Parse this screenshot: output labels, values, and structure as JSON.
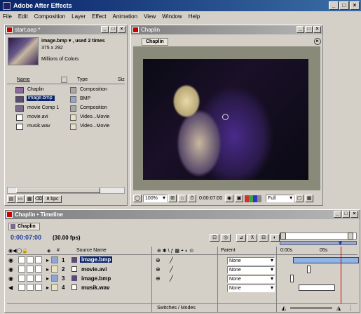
{
  "app": {
    "title": "Adobe After Effects"
  },
  "menu": [
    "File",
    "Edit",
    "Composition",
    "Layer",
    "Effect",
    "Animation",
    "View",
    "Window",
    "Help"
  ],
  "project": {
    "title": "start.aep *",
    "preview_name": "image.bmp ▾ , used 2 times",
    "preview_dims": "375 x 292",
    "preview_colors": "Millions of Colors",
    "col_name": "Name",
    "col_type": "Type",
    "col_extra": "Siz",
    "items": [
      {
        "name": "Chaplin",
        "type": "Composition",
        "swatch": "#a8a8a8"
      },
      {
        "name": "image.bmp",
        "type": "BMP",
        "swatch": "#8fa5d8"
      },
      {
        "name": "movie Comp 1",
        "type": "Composition",
        "swatch": "#a8a8a8"
      },
      {
        "name": "movie.avi",
        "type": "Video...Movie",
        "swatch": "#e8e0c0"
      },
      {
        "name": "musik.wav",
        "type": "Video...Movie",
        "swatch": "#e8e0c0"
      }
    ],
    "footer_bpc": "8 bpc"
  },
  "comp": {
    "title": "Chaplin",
    "tab": "Chaplin",
    "zoom": "100%",
    "timecode": "0:00:07:00",
    "quality": "Full"
  },
  "timeline": {
    "title": "Chaplin • Timeline",
    "tab": "Chaplin",
    "timecode": "0:00:07:00",
    "fps": "(30.00 fps)",
    "col_num": "#",
    "col_source": "Source Name",
    "col_parent": "Parent",
    "ruler_start": "0:00s",
    "ruler_mid": "05s",
    "switches_label": "Switches / Modes",
    "layers": [
      {
        "num": "1",
        "name": "image.bmp",
        "parent": "None"
      },
      {
        "num": "2",
        "name": "movie.avi",
        "parent": "None"
      },
      {
        "num": "3",
        "name": "image.bmp",
        "parent": "None"
      },
      {
        "num": "4",
        "name": "musik.wav",
        "parent": "None"
      }
    ]
  },
  "colors": {
    "titlebar": "#0a246a",
    "selection": "#0a246a",
    "timeline_bar": "#8fb4e6",
    "playhead": "#cc0000"
  }
}
